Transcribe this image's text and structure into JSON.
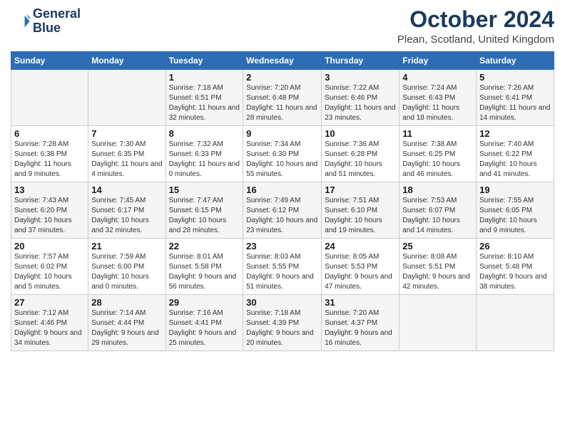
{
  "logo": {
    "line1": "General",
    "line2": "Blue"
  },
  "title": "October 2024",
  "location": "Plean, Scotland, United Kingdom",
  "headers": [
    "Sunday",
    "Monday",
    "Tuesday",
    "Wednesday",
    "Thursday",
    "Friday",
    "Saturday"
  ],
  "weeks": [
    [
      {
        "day": "",
        "sunrise": "",
        "sunset": "",
        "daylight": ""
      },
      {
        "day": "",
        "sunrise": "",
        "sunset": "",
        "daylight": ""
      },
      {
        "day": "1",
        "sunrise": "Sunrise: 7:18 AM",
        "sunset": "Sunset: 6:51 PM",
        "daylight": "Daylight: 11 hours and 32 minutes."
      },
      {
        "day": "2",
        "sunrise": "Sunrise: 7:20 AM",
        "sunset": "Sunset: 6:48 PM",
        "daylight": "Daylight: 11 hours and 28 minutes."
      },
      {
        "day": "3",
        "sunrise": "Sunrise: 7:22 AM",
        "sunset": "Sunset: 6:46 PM",
        "daylight": "Daylight: 11 hours and 23 minutes."
      },
      {
        "day": "4",
        "sunrise": "Sunrise: 7:24 AM",
        "sunset": "Sunset: 6:43 PM",
        "daylight": "Daylight: 11 hours and 18 minutes."
      },
      {
        "day": "5",
        "sunrise": "Sunrise: 7:26 AM",
        "sunset": "Sunset: 6:41 PM",
        "daylight": "Daylight: 11 hours and 14 minutes."
      }
    ],
    [
      {
        "day": "6",
        "sunrise": "Sunrise: 7:28 AM",
        "sunset": "Sunset: 6:38 PM",
        "daylight": "Daylight: 11 hours and 9 minutes."
      },
      {
        "day": "7",
        "sunrise": "Sunrise: 7:30 AM",
        "sunset": "Sunset: 6:35 PM",
        "daylight": "Daylight: 11 hours and 4 minutes."
      },
      {
        "day": "8",
        "sunrise": "Sunrise: 7:32 AM",
        "sunset": "Sunset: 6:33 PM",
        "daylight": "Daylight: 11 hours and 0 minutes."
      },
      {
        "day": "9",
        "sunrise": "Sunrise: 7:34 AM",
        "sunset": "Sunset: 6:30 PM",
        "daylight": "Daylight: 10 hours and 55 minutes."
      },
      {
        "day": "10",
        "sunrise": "Sunrise: 7:36 AM",
        "sunset": "Sunset: 6:28 PM",
        "daylight": "Daylight: 10 hours and 51 minutes."
      },
      {
        "day": "11",
        "sunrise": "Sunrise: 7:38 AM",
        "sunset": "Sunset: 6:25 PM",
        "daylight": "Daylight: 10 hours and 46 minutes."
      },
      {
        "day": "12",
        "sunrise": "Sunrise: 7:40 AM",
        "sunset": "Sunset: 6:22 PM",
        "daylight": "Daylight: 10 hours and 41 minutes."
      }
    ],
    [
      {
        "day": "13",
        "sunrise": "Sunrise: 7:43 AM",
        "sunset": "Sunset: 6:20 PM",
        "daylight": "Daylight: 10 hours and 37 minutes."
      },
      {
        "day": "14",
        "sunrise": "Sunrise: 7:45 AM",
        "sunset": "Sunset: 6:17 PM",
        "daylight": "Daylight: 10 hours and 32 minutes."
      },
      {
        "day": "15",
        "sunrise": "Sunrise: 7:47 AM",
        "sunset": "Sunset: 6:15 PM",
        "daylight": "Daylight: 10 hours and 28 minutes."
      },
      {
        "day": "16",
        "sunrise": "Sunrise: 7:49 AM",
        "sunset": "Sunset: 6:12 PM",
        "daylight": "Daylight: 10 hours and 23 minutes."
      },
      {
        "day": "17",
        "sunrise": "Sunrise: 7:51 AM",
        "sunset": "Sunset: 6:10 PM",
        "daylight": "Daylight: 10 hours and 19 minutes."
      },
      {
        "day": "18",
        "sunrise": "Sunrise: 7:53 AM",
        "sunset": "Sunset: 6:07 PM",
        "daylight": "Daylight: 10 hours and 14 minutes."
      },
      {
        "day": "19",
        "sunrise": "Sunrise: 7:55 AM",
        "sunset": "Sunset: 6:05 PM",
        "daylight": "Daylight: 10 hours and 9 minutes."
      }
    ],
    [
      {
        "day": "20",
        "sunrise": "Sunrise: 7:57 AM",
        "sunset": "Sunset: 6:02 PM",
        "daylight": "Daylight: 10 hours and 5 minutes."
      },
      {
        "day": "21",
        "sunrise": "Sunrise: 7:59 AM",
        "sunset": "Sunset: 6:00 PM",
        "daylight": "Daylight: 10 hours and 0 minutes."
      },
      {
        "day": "22",
        "sunrise": "Sunrise: 8:01 AM",
        "sunset": "Sunset: 5:58 PM",
        "daylight": "Daylight: 9 hours and 56 minutes."
      },
      {
        "day": "23",
        "sunrise": "Sunrise: 8:03 AM",
        "sunset": "Sunset: 5:55 PM",
        "daylight": "Daylight: 9 hours and 51 minutes."
      },
      {
        "day": "24",
        "sunrise": "Sunrise: 8:05 AM",
        "sunset": "Sunset: 5:53 PM",
        "daylight": "Daylight: 9 hours and 47 minutes."
      },
      {
        "day": "25",
        "sunrise": "Sunrise: 8:08 AM",
        "sunset": "Sunset: 5:51 PM",
        "daylight": "Daylight: 9 hours and 42 minutes."
      },
      {
        "day": "26",
        "sunrise": "Sunrise: 8:10 AM",
        "sunset": "Sunset: 5:48 PM",
        "daylight": "Daylight: 9 hours and 38 minutes."
      }
    ],
    [
      {
        "day": "27",
        "sunrise": "Sunrise: 7:12 AM",
        "sunset": "Sunset: 4:46 PM",
        "daylight": "Daylight: 9 hours and 34 minutes."
      },
      {
        "day": "28",
        "sunrise": "Sunrise: 7:14 AM",
        "sunset": "Sunset: 4:44 PM",
        "daylight": "Daylight: 9 hours and 29 minutes."
      },
      {
        "day": "29",
        "sunrise": "Sunrise: 7:16 AM",
        "sunset": "Sunset: 4:41 PM",
        "daylight": "Daylight: 9 hours and 25 minutes."
      },
      {
        "day": "30",
        "sunrise": "Sunrise: 7:18 AM",
        "sunset": "Sunset: 4:39 PM",
        "daylight": "Daylight: 9 hours and 20 minutes."
      },
      {
        "day": "31",
        "sunrise": "Sunrise: 7:20 AM",
        "sunset": "Sunset: 4:37 PM",
        "daylight": "Daylight: 9 hours and 16 minutes."
      },
      {
        "day": "",
        "sunrise": "",
        "sunset": "",
        "daylight": ""
      },
      {
        "day": "",
        "sunrise": "",
        "sunset": "",
        "daylight": ""
      }
    ]
  ]
}
